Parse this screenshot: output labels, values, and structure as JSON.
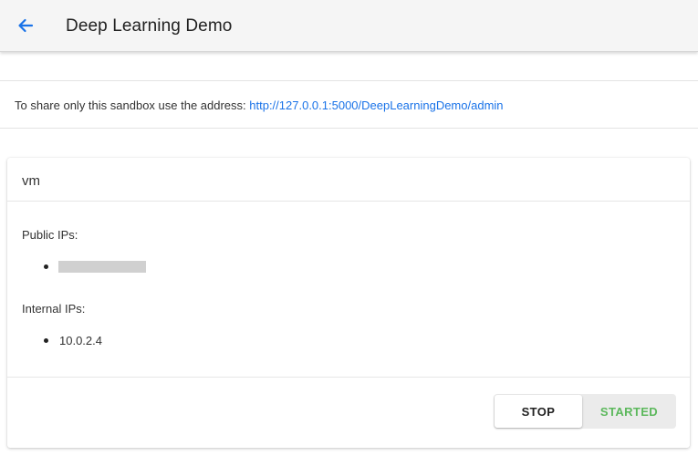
{
  "header": {
    "back_icon": "arrow-left-icon",
    "title": "Deep Learning Demo"
  },
  "share": {
    "text": "To share only this sandbox use the address: ",
    "link": "http://127.0.0.1:5000/DeepLearningDemo/admin"
  },
  "card": {
    "title": "vm",
    "public_ips_label": "Public IPs:",
    "public_ips": [
      "[redacted]"
    ],
    "internal_ips_label": "Internal IPs:",
    "internal_ips": [
      "10.0.2.4"
    ],
    "stop_label": "STOP",
    "status_label": "STARTED"
  },
  "colors": {
    "accent": "#1a73e8",
    "status_started": "#5cb85c",
    "header_bg": "#f5f5f5"
  }
}
